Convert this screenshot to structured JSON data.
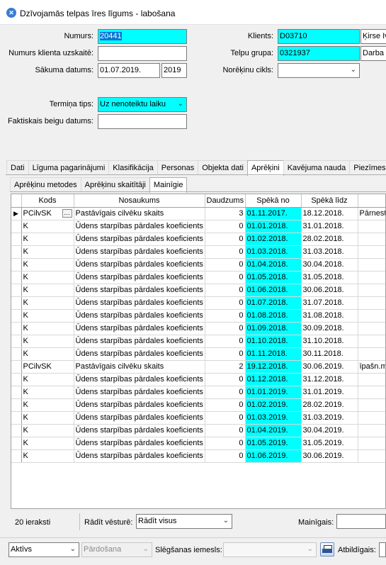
{
  "window": {
    "title": "Dzīvojamās telpas īres līgums - labošana"
  },
  "form": {
    "numurs_label": "Numurs:",
    "numurs_value": "20441",
    "klients_label": "Klients:",
    "klients_value": "D03710",
    "klients_name": "Ķirse Iv",
    "numurs_klienta_label": "Numurs klienta uzskaitē:",
    "numurs_klienta_value": "",
    "telpu_grupa_label": "Telpu grupa:",
    "telpu_grupa_value": "0321937",
    "telpu_grupa_name": "Darba",
    "sakuma_label": "Sākuma datums:",
    "sakuma_value": "01.07.2019.",
    "sakuma_year": "2019",
    "norekinu_label": "Norēķinu cikls:",
    "norekinu_value": "",
    "termina_label": "Termiņa tips:",
    "termina_value": "Uz nenoteiktu laiku",
    "faktiskais_label": "Faktiskais beigu datums:",
    "faktiskais_value": ""
  },
  "tabs_main": [
    "Dati",
    "Līguma pagarinājumi",
    "Klasifikācija",
    "Personas",
    "Objekta dati",
    "Aprēķini",
    "Kavējuma nauda",
    "Piezīmes"
  ],
  "tabs_main_active": "Aprēķini",
  "tabs_sub": [
    "Aprēķinu metodes",
    "Aprēķinu skaitītāji",
    "Mainīgie"
  ],
  "tabs_sub_active": "Mainīgie",
  "grid": {
    "columns": [
      "Kods",
      "Nosaukums",
      "Daudzums",
      "Spēkā no",
      "Spēkā līdz",
      ""
    ],
    "rows": [
      {
        "kods": "PCilvSK",
        "nosaukums": "Pastāvīgais cilvēku skaits",
        "daudzums": "3",
        "no": "01.11.2017.",
        "lidz": "18.12.2018.",
        "extra": "Pārnest"
      },
      {
        "kods": "K",
        "nosaukums": "Ūdens starpības pārdales koeficients",
        "daudzums": "0",
        "no": "01.01.2018.",
        "lidz": "31.01.2018.",
        "extra": ""
      },
      {
        "kods": "K",
        "nosaukums": "Ūdens starpības pārdales koeficients",
        "daudzums": "0",
        "no": "01.02.2018.",
        "lidz": "28.02.2018.",
        "extra": ""
      },
      {
        "kods": "K",
        "nosaukums": "Ūdens starpības pārdales koeficients",
        "daudzums": "0",
        "no": "01.03.2018.",
        "lidz": "31.03.2018.",
        "extra": ""
      },
      {
        "kods": "K",
        "nosaukums": "Ūdens starpības pārdales koeficients",
        "daudzums": "0",
        "no": "01.04.2018.",
        "lidz": "30.04.2018.",
        "extra": ""
      },
      {
        "kods": "K",
        "nosaukums": "Ūdens starpības pārdales koeficients",
        "daudzums": "0",
        "no": "01.05.2018.",
        "lidz": "31.05.2018.",
        "extra": ""
      },
      {
        "kods": "K",
        "nosaukums": "Ūdens starpības pārdales koeficients",
        "daudzums": "0",
        "no": "01.06.2018.",
        "lidz": "30.06.2018.",
        "extra": ""
      },
      {
        "kods": "K",
        "nosaukums": "Ūdens starpības pārdales koeficients",
        "daudzums": "0",
        "no": "01.07.2018.",
        "lidz": "31.07.2018.",
        "extra": ""
      },
      {
        "kods": "K",
        "nosaukums": "Ūdens starpības pārdales koeficients",
        "daudzums": "0",
        "no": "01.08.2018.",
        "lidz": "31.08.2018.",
        "extra": ""
      },
      {
        "kods": "K",
        "nosaukums": "Ūdens starpības pārdales koeficients",
        "daudzums": "0",
        "no": "01.09.2018.",
        "lidz": "30.09.2018.",
        "extra": ""
      },
      {
        "kods": "K",
        "nosaukums": "Ūdens starpības pārdales koeficients",
        "daudzums": "0",
        "no": "01.10.2018.",
        "lidz": "31.10.2018.",
        "extra": ""
      },
      {
        "kods": "K",
        "nosaukums": "Ūdens starpības pārdales koeficients",
        "daudzums": "0",
        "no": "01.11.2018.",
        "lidz": "30.11.2018.",
        "extra": ""
      },
      {
        "kods": "PCilvSK",
        "nosaukums": "Pastāvīgais cilvēku skaits",
        "daudzums": "2",
        "no": "19.12.2018.",
        "lidz": "30.06.2019.",
        "extra": "īpašn.m"
      },
      {
        "kods": "K",
        "nosaukums": "Ūdens starpības pārdales koeficients",
        "daudzums": "0",
        "no": "01.12.2018.",
        "lidz": "31.12.2018.",
        "extra": ""
      },
      {
        "kods": "K",
        "nosaukums": "Ūdens starpības pārdales koeficients",
        "daudzums": "0",
        "no": "01.01.2019.",
        "lidz": "31.01.2019.",
        "extra": ""
      },
      {
        "kods": "K",
        "nosaukums": "Ūdens starpības pārdales koeficients",
        "daudzums": "0",
        "no": "01.02.2019.",
        "lidz": "28.02.2019.",
        "extra": ""
      },
      {
        "kods": "K",
        "nosaukums": "Ūdens starpības pārdales koeficients",
        "daudzums": "0",
        "no": "01.03.2019.",
        "lidz": "31.03.2019.",
        "extra": ""
      },
      {
        "kods": "K",
        "nosaukums": "Ūdens starpības pārdales koeficients",
        "daudzums": "0",
        "no": "01.04.2019.",
        "lidz": "30.04.2019.",
        "extra": ""
      },
      {
        "kods": "K",
        "nosaukums": "Ūdens starpības pārdales koeficients",
        "daudzums": "0",
        "no": "01.05.2019.",
        "lidz": "31.05.2019.",
        "extra": ""
      },
      {
        "kods": "K",
        "nosaukums": "Ūdens starpības pārdales koeficients",
        "daudzums": "0",
        "no": "01.06.2019.",
        "lidz": "30.06.2019.",
        "extra": ""
      }
    ]
  },
  "bottom": {
    "count_text": "20 ieraksti",
    "radit_label": "Rādīt vēsturē:",
    "radit_value": "Rādīt visus",
    "mainigais_label": "Mainīgais:",
    "mainigais_value": ""
  },
  "status": {
    "status_value": "Aktīvs",
    "pardosana_value": "Pārdošana",
    "slegsanas_label": "Slēgšanas iemesls:",
    "slegsanas_value": "",
    "atbildigais_label": "Atbildīgais:"
  },
  "colors": {
    "highlight": "#00ffff",
    "selection": "#0078d7"
  }
}
